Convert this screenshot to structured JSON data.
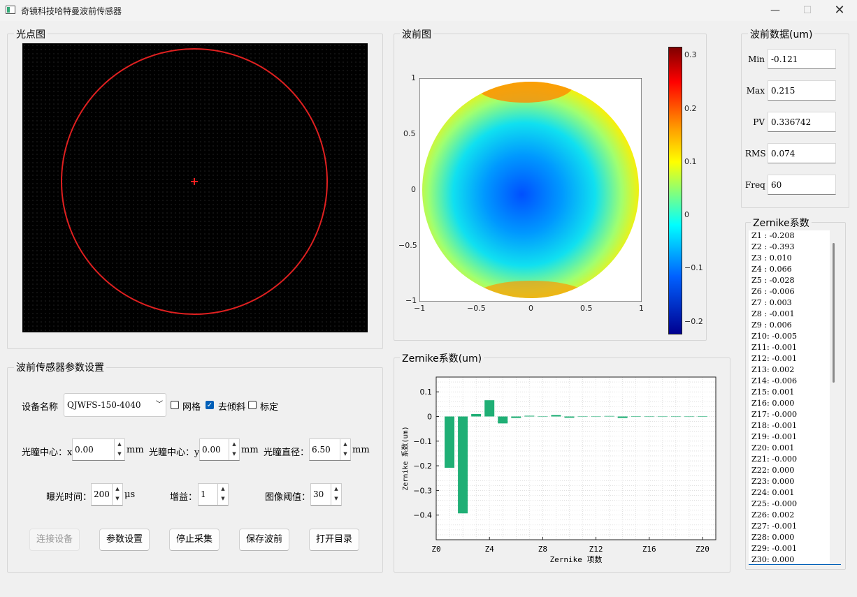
{
  "window": {
    "title": "奇镜科技哈特曼波前传感器"
  },
  "spot_panel": {
    "title": "光点图",
    "circle_color": "#e02020",
    "center_marker_color": "#ff2020"
  },
  "wavefront_panel": {
    "title": "波前图",
    "x_ticks": [
      "−1",
      "−0.5",
      "0",
      "0.5",
      "1"
    ],
    "y_ticks": [
      "1",
      "0.5",
      "0",
      "−0.5",
      "−1"
    ],
    "colorbar_ticks": [
      "0.3",
      "0.2",
      "0.1",
      "0",
      "−0.1",
      "−0.2"
    ]
  },
  "wavefront_data": {
    "title": "波前数据(um)",
    "fields": [
      {
        "label": "Min",
        "value": "-0.121"
      },
      {
        "label": "Max",
        "value": "0.215"
      },
      {
        "label": "PV",
        "value": "0.336742"
      },
      {
        "label": "RMS",
        "value": "0.074"
      },
      {
        "label": "Freq",
        "value": "60"
      }
    ]
  },
  "zernike_list": {
    "title": "Zernike系数",
    "items": [
      "Z1 : -0.208",
      "Z2 : -0.393",
      "Z3 :  0.010",
      "Z4 :  0.066",
      "Z5 : -0.028",
      "Z6 : -0.006",
      "Z7 :  0.003",
      "Z8 : -0.001",
      "Z9 :  0.006",
      "Z10:  -0.005",
      "Z11:  -0.001",
      "Z12:  -0.001",
      "Z13:  0.002",
      "Z14:  -0.006",
      "Z15:  0.001",
      "Z16:  0.000",
      "Z17:  -0.000",
      "Z18:  -0.001",
      "Z19:  -0.001",
      "Z20:  0.001",
      "Z21:  -0.000",
      "Z22:  0.000",
      "Z23:  0.000",
      "Z24:  0.001",
      "Z25:  -0.000",
      "Z26:  0.002",
      "Z27:  -0.001",
      "Z28:  0.000",
      "Z29:  -0.001",
      "Z30:  0.000"
    ]
  },
  "params_panel": {
    "title": "波前传感器参数设置",
    "device_label": "设备名称",
    "device_value": "QJWFS-150-4040",
    "checkboxes": [
      {
        "label": "网格",
        "checked": false
      },
      {
        "label": "去倾斜",
        "checked": true
      },
      {
        "label": "标定",
        "checked": false
      }
    ],
    "pupil_x_label": "光瞳中心：x",
    "pupil_x_value": "0.00",
    "pupil_y_label": "光瞳中心：y",
    "pupil_y_value": "0.00",
    "pupil_d_label": "光瞳直径：",
    "pupil_d_value": "6.50",
    "unit_mm": "mm",
    "exposure_label": "曝光时间：",
    "exposure_value": "200",
    "exposure_unit": "μs",
    "gain_label": "增益：",
    "gain_value": "1",
    "threshold_label": "图像阈值：",
    "threshold_value": "30",
    "buttons": {
      "connect": "连接设备",
      "settings": "参数设置",
      "stop": "停止采集",
      "save": "保存波前",
      "open_dir": "打开目录"
    }
  },
  "zernike_chart_panel": {
    "title": "Zernike系数(um)"
  },
  "chart_data": {
    "type": "bar",
    "title": "",
    "xlabel": "Zernike 项数",
    "ylabel": "Zernike 系数(um)",
    "xlim": [
      0,
      21
    ],
    "ylim": [
      -0.5,
      0.16
    ],
    "x_ticks": [
      "Z0",
      "Z4",
      "Z8",
      "Z12",
      "Z16",
      "Z20"
    ],
    "y_ticks": [
      "0.1",
      "0",
      "−0.1",
      "−0.2",
      "−0.3",
      "−0.4"
    ],
    "bar_color": "#1faf75",
    "grid": true,
    "x": [
      1,
      2,
      3,
      4,
      5,
      6,
      7,
      8,
      9,
      10,
      11,
      12,
      13,
      14,
      15,
      16,
      17,
      18,
      19,
      20
    ],
    "values": [
      -0.208,
      -0.393,
      0.01,
      0.066,
      -0.028,
      -0.006,
      0.003,
      -0.001,
      0.006,
      -0.005,
      -0.001,
      -0.001,
      0.002,
      -0.006,
      0.001,
      0.0,
      -0.0,
      -0.001,
      -0.001,
      0.001
    ]
  }
}
